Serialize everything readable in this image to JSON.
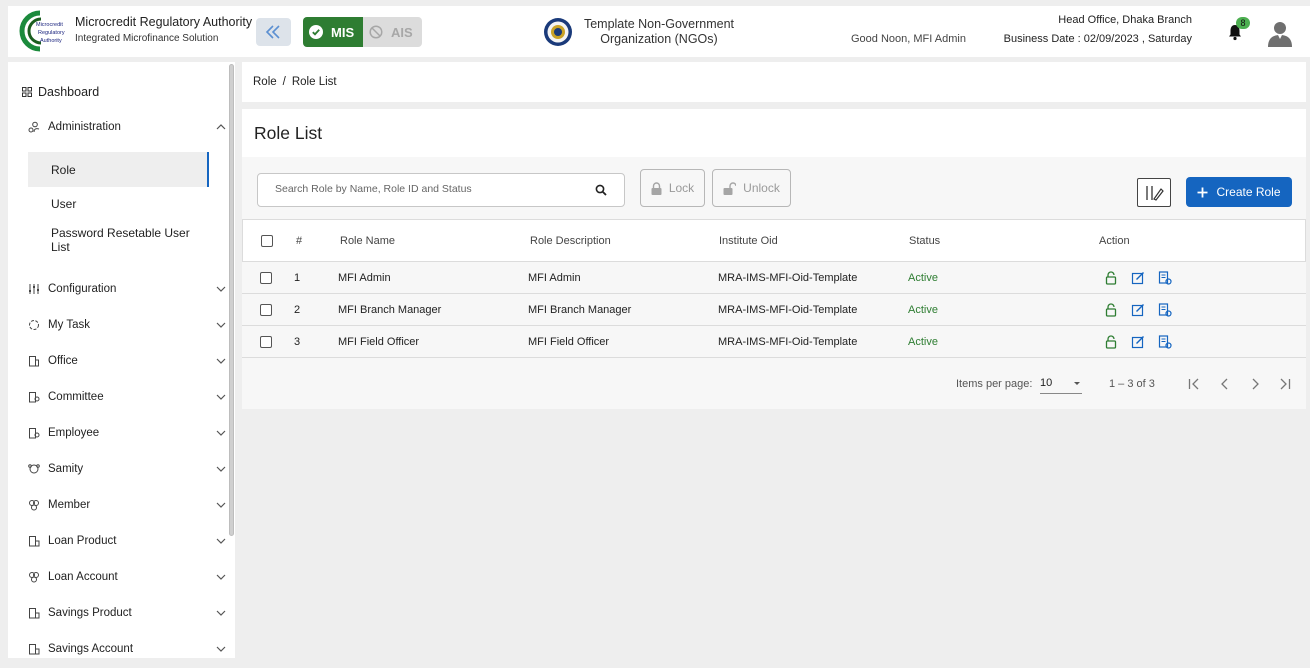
{
  "header": {
    "brand_title": "Microcredit Regulatory Authority",
    "brand_subtitle": "Integrated Microfinance Solution",
    "logo_text": [
      "Microcredit",
      "Regulatory",
      "Authority"
    ],
    "mis_label": "MIS",
    "ais_label": "AIS",
    "org_name_line1": "Template Non-Government",
    "org_name_line2": "Organization (NGOs)",
    "greeting": "Good Noon, MFI Admin",
    "branch": "Head Office, Dhaka Branch",
    "business_date": "Business Date : 02/09/2023 , Saturday",
    "notification_count": "8"
  },
  "sidebar": {
    "dashboard": "Dashboard",
    "administration": "Administration",
    "sub_items": [
      "Role",
      "User",
      "Password Resetable User List"
    ],
    "items": [
      {
        "label": "Configuration",
        "icon": "sliders-icon"
      },
      {
        "label": "My Task",
        "icon": "refresh-icon"
      },
      {
        "label": "Office",
        "icon": "building-icon"
      },
      {
        "label": "Committee",
        "icon": "committee-icon"
      },
      {
        "label": "Employee",
        "icon": "employee-icon"
      },
      {
        "label": "Samity",
        "icon": "samity-icon"
      },
      {
        "label": "Member",
        "icon": "member-icon"
      },
      {
        "label": "Loan Product",
        "icon": "loan-product-icon"
      },
      {
        "label": "Loan Account",
        "icon": "loan-account-icon"
      },
      {
        "label": "Savings Product",
        "icon": "savings-product-icon"
      },
      {
        "label": "Savings Account",
        "icon": "savings-account-icon"
      }
    ]
  },
  "breadcrumb": {
    "root": "Role",
    "separator": "/",
    "current": "Role List"
  },
  "page": {
    "title": "Role List",
    "search_placeholder": "Search Role by Name, Role ID and Status",
    "lock_label": "Lock",
    "unlock_label": "Unlock",
    "create_label": "Create Role"
  },
  "table": {
    "headers": [
      "#",
      "Role Name",
      "Role Description",
      "Institute Oid",
      "Status",
      "Action"
    ],
    "rows": [
      {
        "no": "1",
        "name": "MFI Admin",
        "description": "MFI Admin",
        "oid": "MRA-IMS-MFI-Oid-Template",
        "status": "Active"
      },
      {
        "no": "2",
        "name": "MFI Branch Manager",
        "description": "MFI Branch Manager",
        "oid": "MRA-IMS-MFI-Oid-Template",
        "status": "Active"
      },
      {
        "no": "3",
        "name": "MFI Field Officer",
        "description": "MFI Field Officer",
        "oid": "MRA-IMS-MFI-Oid-Template",
        "status": "Active"
      }
    ]
  },
  "pagination": {
    "label": "Items per page:",
    "per_page": "10",
    "range": "1 – 3 of 3"
  },
  "colors": {
    "primary": "#1565c0",
    "success": "#2e7d32",
    "badge": "#4caf50"
  }
}
